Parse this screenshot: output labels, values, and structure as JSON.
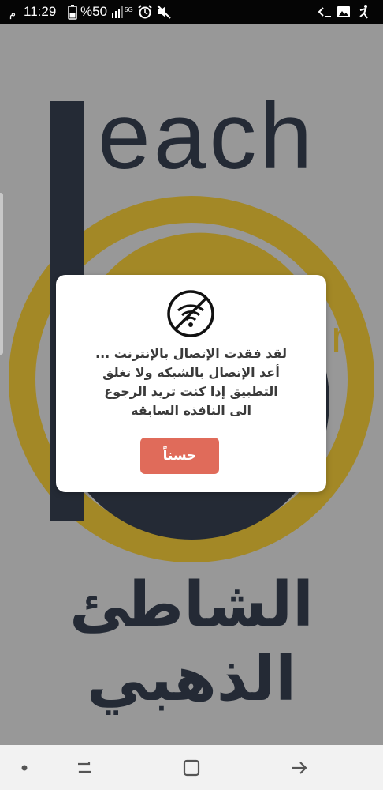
{
  "status_bar": {
    "time": "11:29",
    "battery_text": "%50",
    "network_label": "5G",
    "icons": [
      "battery-icon",
      "signal-icon",
      "alarm-icon",
      "mute-icon",
      "code-icon",
      "image-icon",
      "accessibility-icon"
    ]
  },
  "splash": {
    "logo_word": "each",
    "logo_fragment": "n",
    "arabic_title": "الشاطئ الذهبي"
  },
  "dialog": {
    "icon": "no-wifi-icon",
    "message_lines": [
      "لقد فقدت الإتصال بالإنترنت ...",
      "أعد الإتصال بالشبكه ولا تغلق",
      "التطبيق إذا كنت تريد الرجوع",
      "الى النافذه السابقه"
    ],
    "ok_label": "حسناً"
  },
  "nav_bar": {
    "icons": [
      "dot-icon",
      "recent-apps-icon",
      "home-icon",
      "back-icon"
    ]
  },
  "colors": {
    "accent_gold": "#b8920a",
    "logo_navy": "#07101f",
    "button": "#e06b5a"
  }
}
